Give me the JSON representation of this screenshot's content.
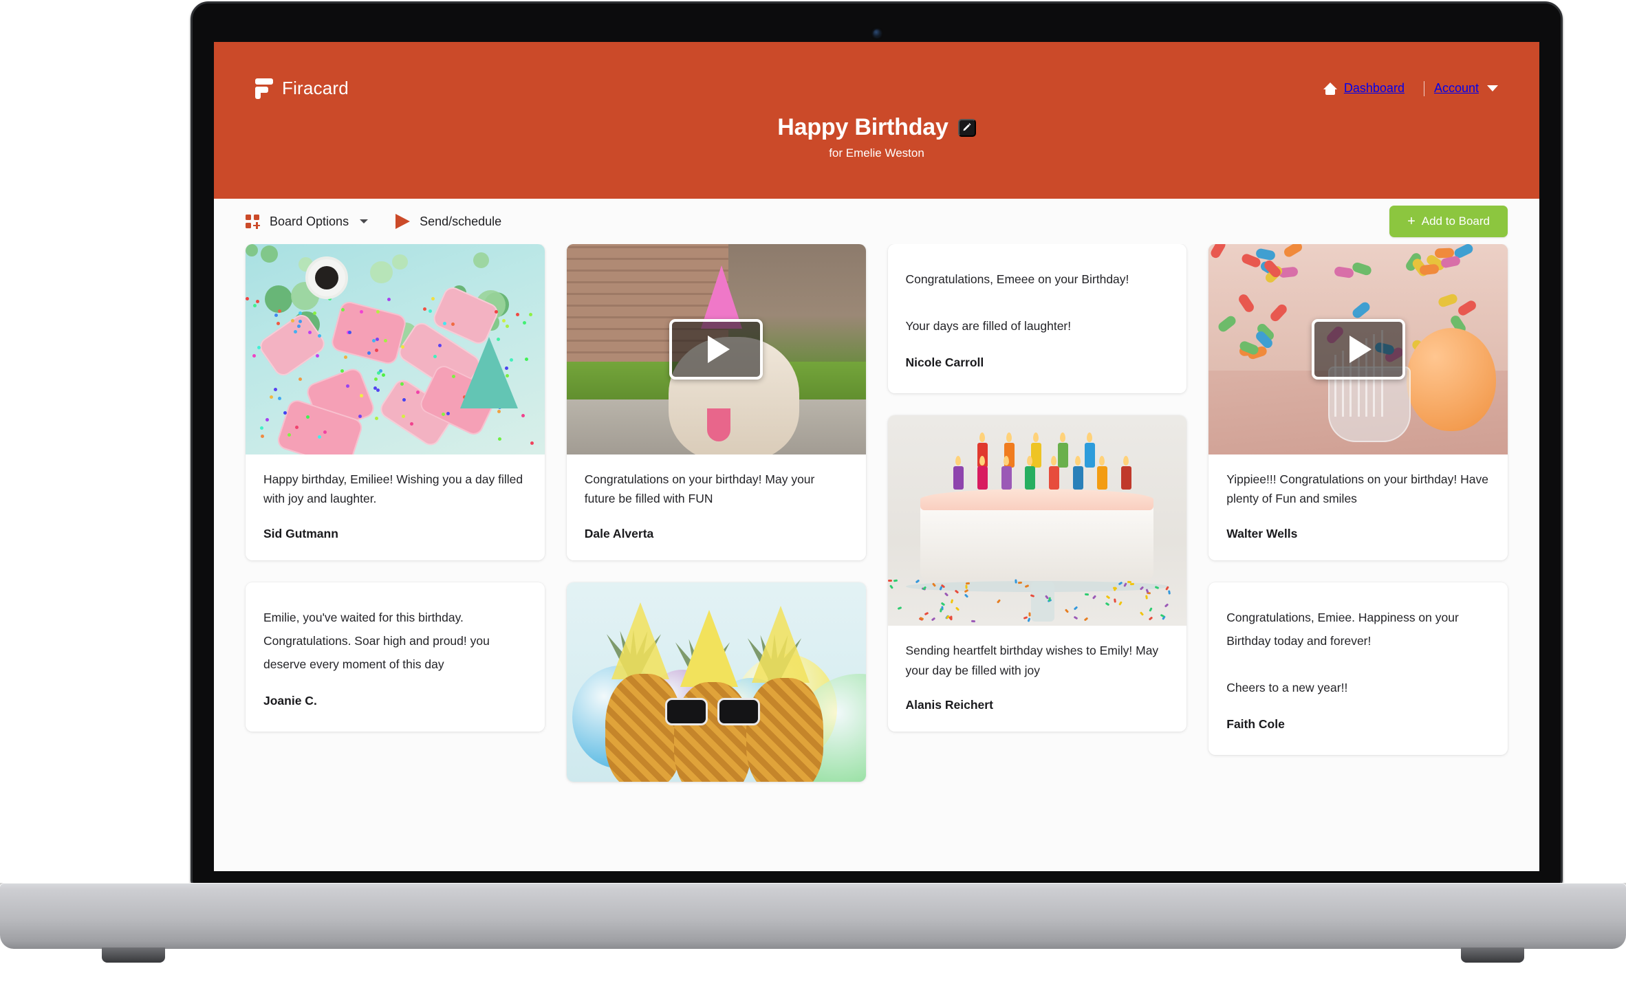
{
  "theme": {
    "brand_color": "#cb4a29",
    "accent_color": "#8cc63f",
    "page_background": "#fbfbfb"
  },
  "header": {
    "brand_name": "Firacard",
    "nav": {
      "dashboard_label": "Dashboard",
      "account_label": "Account"
    },
    "board_title": "Happy Birthday",
    "board_subtitle": "for Emelie Weston",
    "edit_title_label": "Edit"
  },
  "toolbar": {
    "board_options_label": "Board Options",
    "send_schedule_label": "Send/schedule",
    "add_to_board_label": "Add to Board",
    "add_plus": "+"
  },
  "columns": [
    {
      "cards": [
        {
          "type": "image",
          "media": "donuts-with-sprinkles-photo",
          "message": "Happy birthday, Emiliee! Wishing you a day filled with joy and laughter.",
          "author": "Sid Gutmann"
        },
        {
          "type": "text",
          "message": "Emilie, you've waited for this birthday. Congratulations. Soar high and proud! you deserve every moment of this day",
          "author": "Joanie C."
        }
      ]
    },
    {
      "cards": [
        {
          "type": "video",
          "media": "dog-with-party-hat-video",
          "message": "Congratulations on your  birthday! May your future be filled with FUN",
          "author": "Dale Alverta"
        },
        {
          "type": "image-only",
          "media": "pineapples-with-sunglasses-photo",
          "message": "",
          "author": ""
        }
      ]
    },
    {
      "cards": [
        {
          "type": "text",
          "message": "Congratulations, Emeee on your Birthday!\n\nYour days are filled of laughter!",
          "author": "Nicole Carroll"
        },
        {
          "type": "image",
          "media": "birthday-cake-with-candles-photo",
          "message": "Sending heartfelt birthday wishes to Emily! May your day be filled with joy",
          "author": "Alanis Reichert"
        }
      ]
    },
    {
      "cards": [
        {
          "type": "video",
          "media": "candy-and-balloons-video",
          "message": "Yippiee!!! Congratulations on your birthday! Have plenty of Fun and smiles",
          "author": "Walter Wells"
        },
        {
          "type": "text",
          "message": "Congratulations, Emiee. Happiness on your Birthday today and forever!\n\nCheers to a new year!!",
          "author": "Faith Cole"
        }
      ]
    }
  ]
}
